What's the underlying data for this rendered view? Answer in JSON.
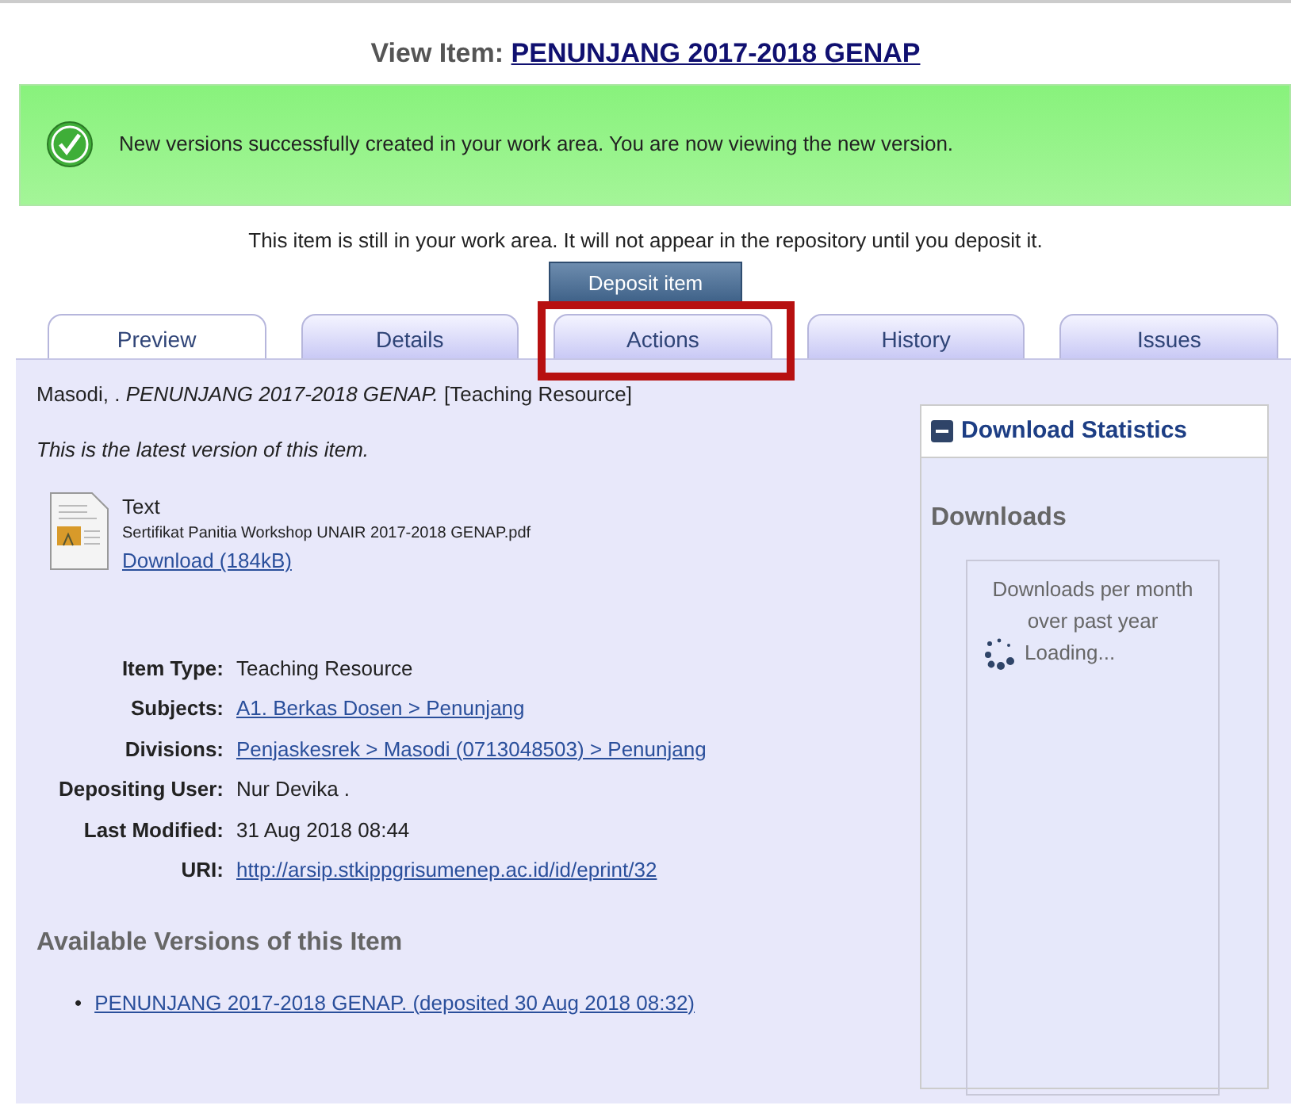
{
  "heading": {
    "label": "View Item:",
    "title": "PENUNJANG 2017-2018 GENAP"
  },
  "alert": {
    "message": "New versions successfully created in your work area. You are now viewing the new version."
  },
  "notice": "This item is still in your work area. It will not appear in the repository until you deposit it.",
  "deposit_button": "Deposit item",
  "tabs": [
    {
      "label": "Preview",
      "selected": true,
      "highlighted": false
    },
    {
      "label": "Details",
      "selected": false,
      "highlighted": false
    },
    {
      "label": "Actions",
      "selected": false,
      "highlighted": true
    },
    {
      "label": "History",
      "selected": false,
      "highlighted": false
    },
    {
      "label": "Issues",
      "selected": false,
      "highlighted": false
    }
  ],
  "citation": {
    "authors": "Masodi, .",
    "title": "PENUNJANG 2017-2018 GENAP.",
    "type": "[Teaching Resource]"
  },
  "version_note": "This is the latest version of this item.",
  "document": {
    "format": "Text",
    "filename": "Sertifikat Panitia Workshop UNAIR 2017-2018 GENAP.pdf",
    "download": "Download (184kB)"
  },
  "fields": [
    {
      "label": "Item Type:",
      "value": "Teaching Resource",
      "kind": "text"
    },
    {
      "label": "Subjects:",
      "value": "A1. Berkas Dosen > Penunjang",
      "kind": "link"
    },
    {
      "label": "Divisions:",
      "value": "Penjaskesrek > Masodi (0713048503) > Penunjang",
      "kind": "link"
    },
    {
      "label": "Depositing User:",
      "value": "Nur Devika .",
      "kind": "text"
    },
    {
      "label": "Last Modified:",
      "value": "31 Aug 2018 08:44",
      "kind": "text"
    },
    {
      "label": "URI:",
      "value": "http://arsip.stkippgrisumenep.ac.id/id/eprint/32",
      "kind": "link"
    }
  ],
  "versions": {
    "title": "Available Versions of this Item",
    "marker": "•",
    "items": [
      "PENUNJANG 2017-2018 GENAP. (deposited 30 Aug 2018 08:32)"
    ]
  },
  "stats": {
    "title": "Download Statistics",
    "expanded": true,
    "section": "Downloads",
    "chart_title": "Downloads per month over past year",
    "loading": "Loading..."
  }
}
